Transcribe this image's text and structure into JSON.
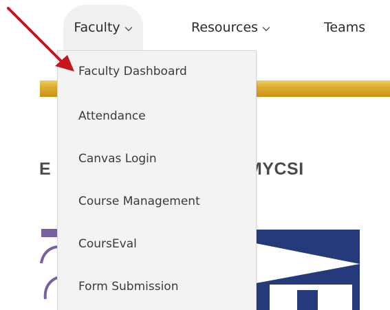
{
  "nav": {
    "items": [
      {
        "label": "Faculty",
        "has_dropdown": true,
        "active": true
      },
      {
        "label": "Resources",
        "has_dropdown": true,
        "active": false
      },
      {
        "label": "Teams",
        "has_dropdown": false,
        "active": false
      }
    ]
  },
  "dropdown": {
    "items": [
      {
        "label": "Faculty Dashboard"
      },
      {
        "label": "Attendance"
      },
      {
        "label": "Canvas Login"
      },
      {
        "label": "Course Management"
      },
      {
        "label": "CoursEval"
      },
      {
        "label": "Form Submission"
      }
    ]
  },
  "page": {
    "heading_left_fragment": "E",
    "heading_right_fragment": "MYCSI"
  },
  "colors": {
    "accent_gold": "#dcaa2c",
    "banner_blue": "#243a7a",
    "banner_purple": "#7b5fa3",
    "annotation_arrow": "#c8141a",
    "menu_background": "#f3f3f3"
  },
  "icons": {
    "dropdown_chevron": "chevron-down-icon",
    "annotation": "red-arrow-annotation"
  }
}
